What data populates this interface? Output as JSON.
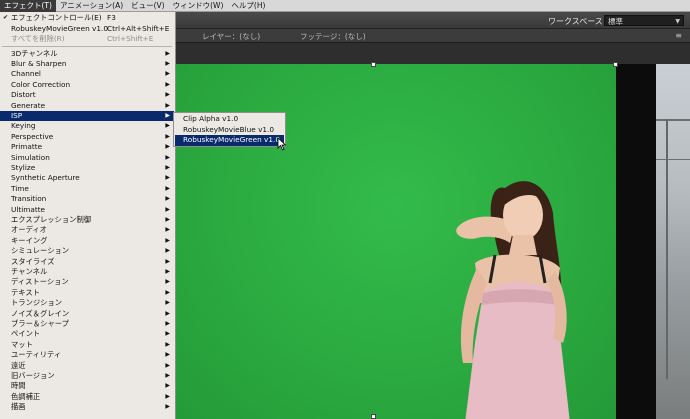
{
  "menubar": {
    "items": [
      "エフェクト(T)",
      "アニメーション(A)",
      "ビュー(V)",
      "ウィンドウ(W)",
      "ヘルプ(H)"
    ]
  },
  "workspace": {
    "label": "ワークスペース：",
    "value": "標準"
  },
  "panel_tabs": {
    "layer": "レイヤー：(なし)",
    "footage": "フッテージ：(なし)"
  },
  "effect_menu": {
    "top_items": [
      {
        "label": "エフェクトコントロール(E)",
        "shortcut": "F3"
      },
      {
        "label": "RobuskeyMovieGreen v1.0",
        "shortcut": "Ctrl+Alt+Shift+E"
      },
      {
        "label": "すべてを削除(R)",
        "shortcut": "Ctrl+Shift+E"
      }
    ],
    "categories": [
      "3Dチャンネル",
      "Blur & Sharpen",
      "Channel",
      "Color Correction",
      "Distort",
      "Generate",
      "ISP",
      "Keying",
      "Perspective",
      "Primatte",
      "Simulation",
      "Stylize",
      "Synthetic Aperture",
      "Time",
      "Transition",
      "Ultimatte",
      "エクスプレッション制御",
      "オーディオ",
      "キーイング",
      "シミュレーション",
      "スタイライズ",
      "チャンネル",
      "ディストーション",
      "テキスト",
      "トランジション",
      "ノイズ＆グレイン",
      "ブラー＆シャープ",
      "ペイント",
      "マット",
      "ユーティリティ",
      "遠近",
      "旧バージョン",
      "時間",
      "色調補正",
      "描画"
    ],
    "selected": "ISP"
  },
  "isp_submenu": {
    "items": [
      "Clip Alpha v1.0",
      "RobuskeyMovieBlue v1.0",
      "RobuskeyMovieGreen v1.0"
    ],
    "selected": "RobuskeyMovieGreen v1.0"
  },
  "colors": {
    "menu_highlight": "#0a2a6e",
    "green_screen": "#2cb042"
  },
  "icons": [
    "checkmark-icon",
    "submenu-arrow-icon",
    "panel-menu-icon",
    "dropdown-arrow-icon",
    "mouse-cursor-icon"
  ]
}
